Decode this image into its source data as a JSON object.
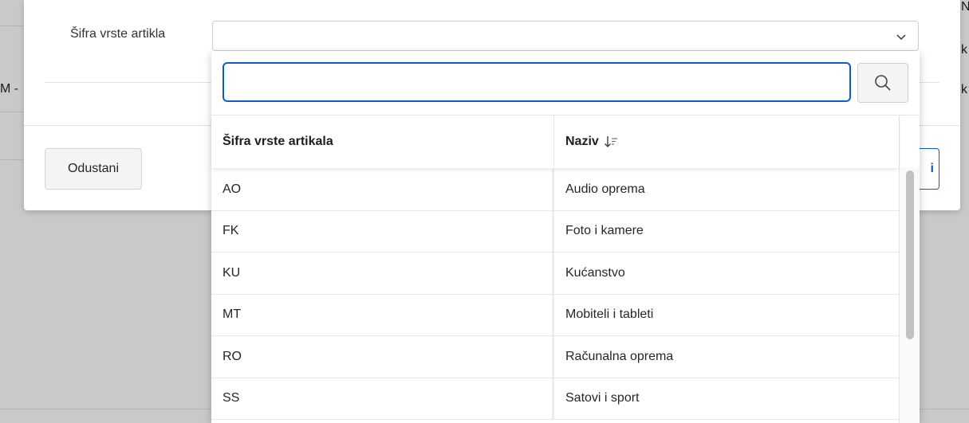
{
  "background": {
    "edge_glimpses": [
      "N",
      "k",
      "k"
    ],
    "left_glimpse": "M -"
  },
  "dialog": {
    "field_label": "Šifra vrste artikla",
    "select_value": "",
    "cancel_label": "Odustani",
    "primary_label": "i"
  },
  "popup": {
    "search": {
      "value": ""
    },
    "columns": [
      {
        "label": "Šifra vrste artikala"
      },
      {
        "label": "Naziv",
        "sort_icon": "sort-descending-icon"
      }
    ],
    "rows": [
      {
        "code": "AO",
        "name": "Audio oprema"
      },
      {
        "code": "FK",
        "name": "Foto i kamere"
      },
      {
        "code": "KU",
        "name": "Kućanstvo"
      },
      {
        "code": "MT",
        "name": "Mobiteli i tableti"
      },
      {
        "code": "RO",
        "name": "Računalna oprema"
      },
      {
        "code": "SS",
        "name": "Satovi i sport"
      }
    ]
  },
  "colors": {
    "accent": "#0a5ec9",
    "overlay": "#c9c9c9"
  }
}
